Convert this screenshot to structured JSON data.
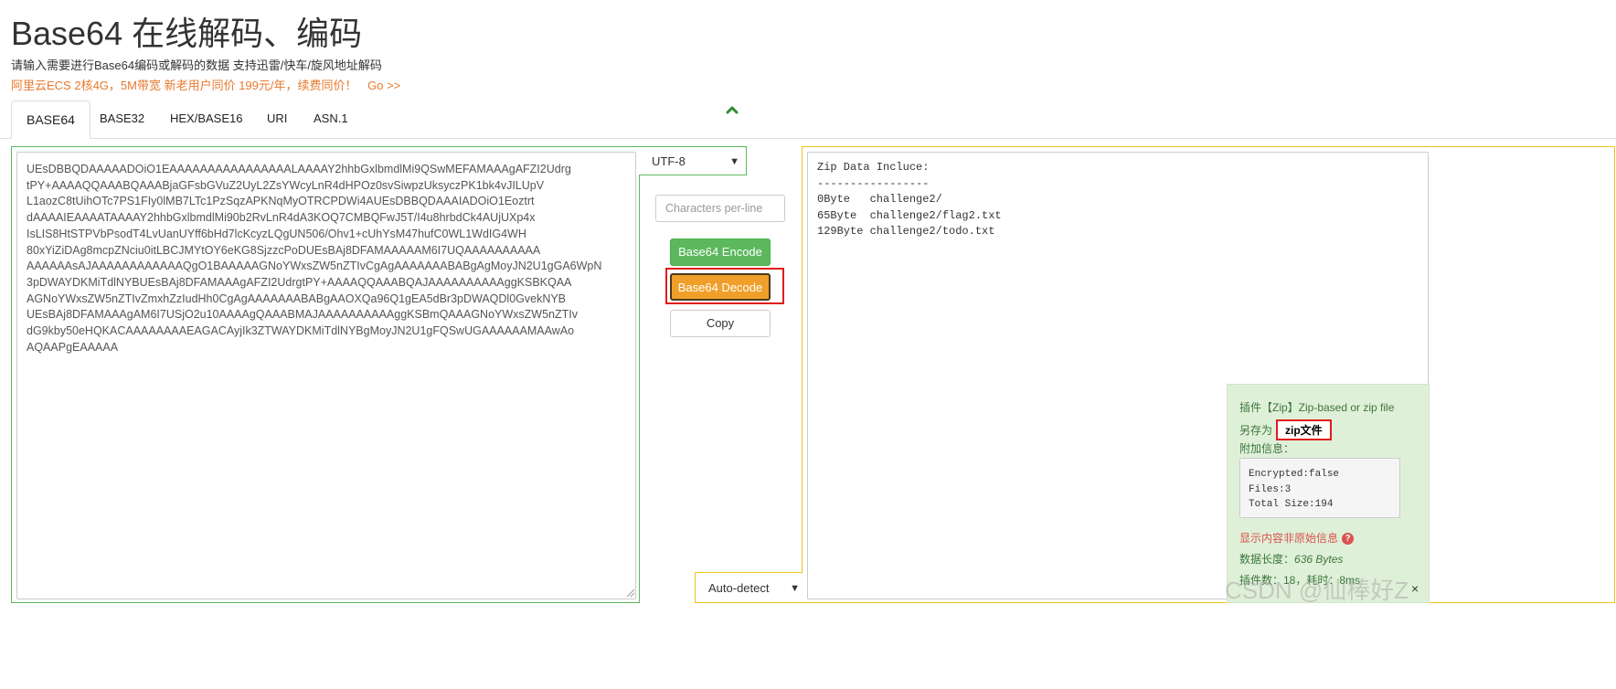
{
  "header": {
    "title": "Base64 在线解码、编码",
    "subtitle": "请输入需要进行Base64编码或解码的数据 支持迅雷/快车/旋风地址解码",
    "promo_text": "阿里云ECS 2核4G，5M带宽 新老用户同价 199元/年，续费同价！",
    "promo_link": "Go >>"
  },
  "tabs": [
    {
      "label": "BASE64",
      "active": true
    },
    {
      "label": "BASE32"
    },
    {
      "label": "HEX/BASE16"
    },
    {
      "label": "URI"
    },
    {
      "label": "ASN.1"
    }
  ],
  "input": {
    "text": "UEsDBBQDAAAAADOiO1EAAAAAAAAAAAAAAAALAAAAY2hhbGxlbmdlMi9QSwMEFAMAAAgAFZI2Udrg\ntPY+AAAAQQAAABQAAABjaGFsbGVuZ2UyL2ZsYWcyLnR4dHPOz0svSiwpzUksyczPK1bk4vJILUpV\nL1aozC8tUihOTc7PS1FIy0lMB7LTc1PzSqzAPKNqMyOTRCPDWi4AUEsDBBQDAAAIADOiO1Eoztrt\ndAAAAIEAAAATAAAAY2hhbGxlbmdlMi90b2RvLnR4dA3KOQ7CMBQFwJ5T/I4u8hrbdCk4AUjUXp4x\nIsLIS8HtSTPVbPsodT4LvUanUYff6bHd7lcKcyzLQgUN506/Ohv1+cUhYsM47hufC0WL1WdIG4WH\n80xYiZiDAg8mcpZNciu0itLBCJMYtOY6eKG8SjzzcPoDUEsBAj8DFAMAAAAAM6I7UQAAAAAAAAAA\nAAAAAAsAJAAAAAAAAAAAAQgO1BAAAAAGNoYWxsZW5nZTIvCgAgAAAAAAABABgAgMoyJN2U1gGA6WpN\n3pDWAYDKMiTdlNYBUEsBAj8DFAMAAAgAFZI2UdrgtPY+AAAAQQAAABQAJAAAAAAAAAAggKSBKQAA\nAGNoYWxsZW5nZTIvZmxhZzIudHh0CgAgAAAAAAABABgAAOXQa96Q1gEA5dBr3pDWAQDl0GvekNYB\nUEsBAj8DFAMAAAgAM6I7USjO2u10AAAAgQAAABMAJAAAAAAAAAAggKSBmQAAAGNoYWxsZW5nZTIv\ndG9kby50eHQKACAAAAAAAAEAGACAyjIk3ZTWAYDKMiTdlNYBgMoyJN2U1gFQSwUGAAAAAAMAAwAo\nAQAAPgEAAAAA"
  },
  "controls": {
    "encoding": "UTF-8",
    "chars_per_line_placeholder": "Characters per-line",
    "encode_label": "Base64 Encode",
    "decode_label": "Base64 Decode",
    "copy_label": "Copy",
    "autodetect": "Auto-detect"
  },
  "output": {
    "text": "Zip Data Incluce:\n-----------------\n0Byte   challenge2/\n65Byte  challenge2/flag2.txt\n129Byte challenge2/todo.txt"
  },
  "plugin": {
    "title": "插件【Zip】Zip-based or zip file",
    "saveas_label": "另存为",
    "saveas_value": "zip文件",
    "extra_label": "附加信息：",
    "meta": "Encrypted:false\nFiles:3\nTotal Size:194",
    "not_raw": "显示内容非原始信息",
    "data_length_label": "数据长度：",
    "data_length_value": "636 Bytes",
    "plugin_count": "插件数：18，耗时：8ms",
    "close": "×"
  },
  "watermark": "CSDN @仙棒好Z",
  "colors": {
    "green": "#5cb85c",
    "orange": "#f0a02a",
    "yellow": "#f0c419",
    "highlight_red": "#e21b1b",
    "promo_orange": "#e8792e"
  }
}
